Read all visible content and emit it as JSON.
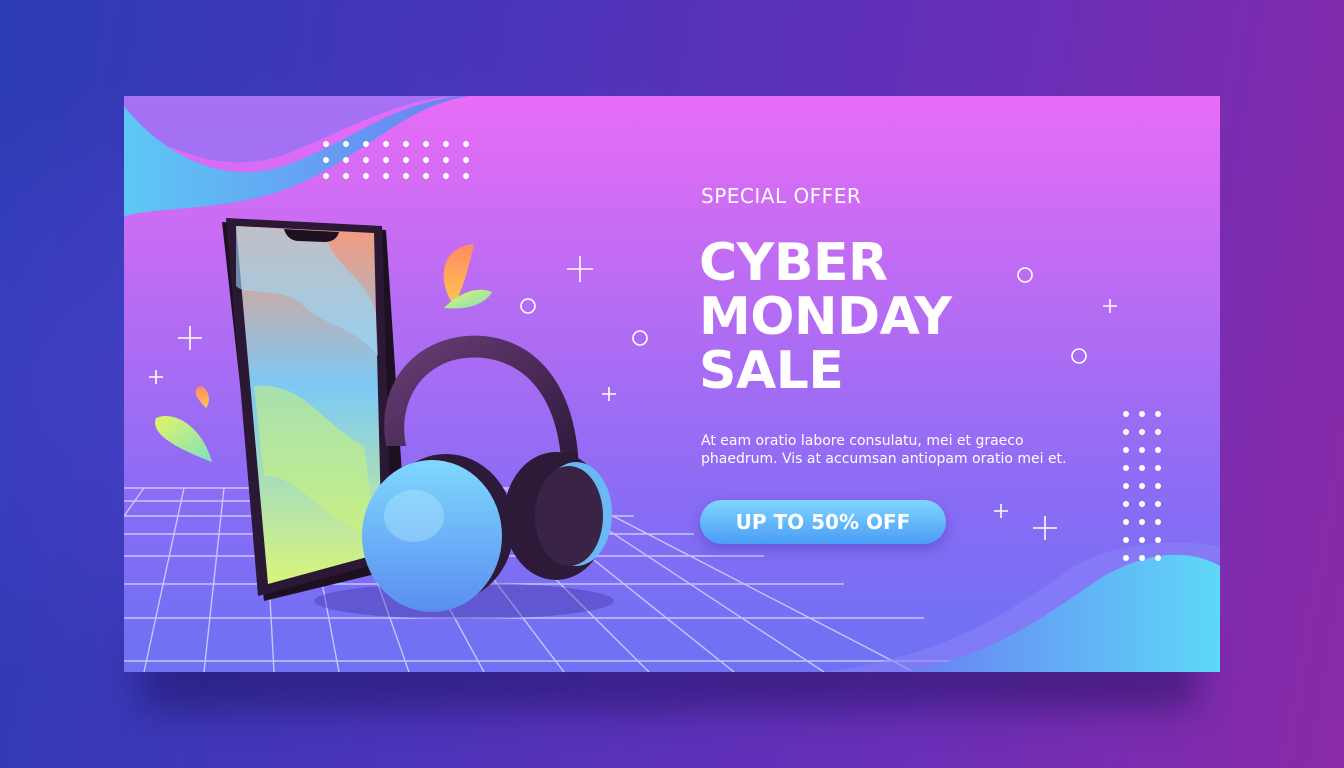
{
  "banner": {
    "eyebrow": "SPECIAL OFFER",
    "headline_lines": [
      "CYBER",
      "MONDAY",
      "SALE"
    ],
    "body_lines": [
      "At eam oratio labore consulatu, mei et graeco",
      "phaedrum. Vis at accumsan antiopam oratio mei et."
    ],
    "cta_label": "UP TO 50% OFF"
  },
  "illustration": {
    "icons": [
      "smartphone-icon",
      "headphones-icon"
    ]
  },
  "colors": {
    "background_left": "#2b3bb4",
    "background_right": "#8a2aa8",
    "banner_top": "#e86cf6",
    "banner_bottom": "#6c72f3",
    "wave_accent": "#5ec8f5",
    "cta_top": "#7fd6ff",
    "cta_bottom": "#4a9df5",
    "text": "#ffffff"
  }
}
